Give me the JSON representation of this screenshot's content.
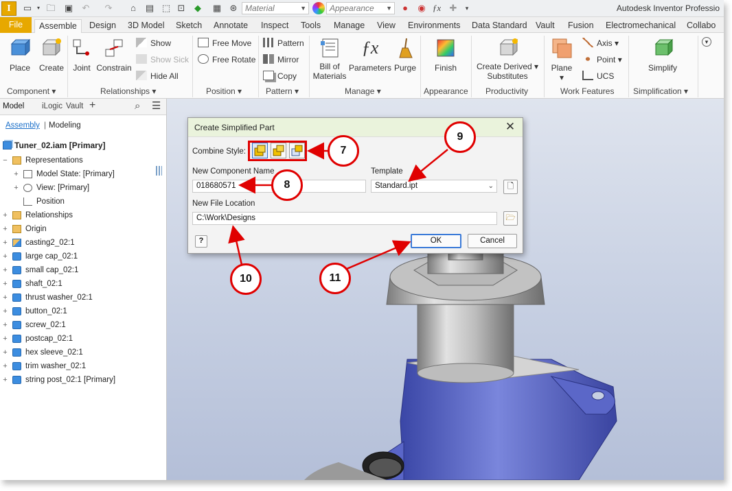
{
  "app": {
    "logo_letter": "I",
    "title": "Autodesk Inventor Professio",
    "material_placeholder": "Material",
    "appearance_placeholder": "Appearance"
  },
  "tabs": [
    "File",
    "Assemble",
    "Design",
    "3D Model",
    "Sketch",
    "Annotate",
    "Inspect",
    "Tools",
    "Manage",
    "View",
    "Environments",
    "Data Standard",
    "Vault",
    "Fusion",
    "Electromechanical",
    "Collabo"
  ],
  "active_tab": "Assemble",
  "ribbon": {
    "component": {
      "label": "Component",
      "place": "Place",
      "create": "Create"
    },
    "relationships": {
      "label": "Relationships",
      "joint": "Joint",
      "constrain": "Constrain",
      "show": "Show",
      "show_sick": "Show Sick",
      "hide_all": "Hide All"
    },
    "position": {
      "label": "Position",
      "free_move": "Free Move",
      "free_rotate": "Free Rotate"
    },
    "pattern": {
      "label": "Pattern",
      "pattern": "Pattern",
      "mirror": "Mirror",
      "copy": "Copy"
    },
    "manage": {
      "label": "Manage",
      "bom_line1": "Bill of",
      "bom_line2": "Materials",
      "parameters": "Parameters",
      "purge": "Purge"
    },
    "appearance": {
      "label": "Appearance",
      "finish": "Finish"
    },
    "productivity": {
      "label": "Productivity",
      "create_derived_line1": "Create Derived",
      "create_derived_line2": "Substitutes"
    },
    "work_features": {
      "label": "Work Features",
      "plane": "Plane",
      "axis": "Axis",
      "point": "Point",
      "ucs": "UCS"
    },
    "simplification": {
      "label": "Simplification",
      "simplify": "Simplify"
    }
  },
  "browser": {
    "tabs": [
      "Model",
      "iLogic",
      "Vault"
    ],
    "subtabs": [
      "Assembly",
      "Modeling"
    ],
    "tree": [
      {
        "label": "Tuner_02.iam [Primary]",
        "level": 0,
        "expander": "",
        "icon": "assembly"
      },
      {
        "label": "Representations",
        "level": 0,
        "expander": "−",
        "icon": "folder"
      },
      {
        "label": "Model State: [Primary]",
        "level": 1,
        "expander": "+",
        "icon": "model-state"
      },
      {
        "label": "View: [Primary]",
        "level": 1,
        "expander": "+",
        "icon": "view"
      },
      {
        "label": "Position",
        "level": 1,
        "expander": "",
        "icon": "position"
      },
      {
        "label": "Relationships",
        "level": 0,
        "expander": "+",
        "icon": "relationships"
      },
      {
        "label": "Origin",
        "level": 0,
        "expander": "+",
        "icon": "folder"
      },
      {
        "label": "casting2_02:1",
        "level": 0,
        "expander": "+",
        "icon": "part-casting"
      },
      {
        "label": "large cap_02:1",
        "level": 0,
        "expander": "+",
        "icon": "part"
      },
      {
        "label": "small cap_02:1",
        "level": 0,
        "expander": "+",
        "icon": "part"
      },
      {
        "label": "shaft_02:1",
        "level": 0,
        "expander": "+",
        "icon": "part"
      },
      {
        "label": "thrust washer_02:1",
        "level": 0,
        "expander": "+",
        "icon": "part"
      },
      {
        "label": "button_02:1",
        "level": 0,
        "expander": "+",
        "icon": "part"
      },
      {
        "label": "screw_02:1",
        "level": 0,
        "expander": "+",
        "icon": "part"
      },
      {
        "label": "postcap_02:1",
        "level": 0,
        "expander": "+",
        "icon": "part"
      },
      {
        "label": "hex sleeve_02:1",
        "level": 0,
        "expander": "+",
        "icon": "part"
      },
      {
        "label": "trim washer_02:1",
        "level": 0,
        "expander": "+",
        "icon": "part"
      },
      {
        "label": "string post_02:1 [Primary]",
        "level": 0,
        "expander": "+",
        "icon": "part"
      }
    ]
  },
  "dialog": {
    "title": "Create Simplified Part",
    "combine_style_label": "Combine Style:",
    "new_component_name_label": "New Component Name",
    "new_component_name_value": "018680571",
    "template_label": "Template",
    "template_value": "Standard.ipt",
    "new_file_location_label": "New File Location",
    "new_file_location_value": "C:\\Work\\Designs",
    "ok_label": "OK",
    "cancel_label": "Cancel"
  },
  "callouts": [
    "7",
    "8",
    "9",
    "10",
    "11"
  ],
  "colors": {
    "accent_file_tab": "#e7a800",
    "callout_red": "#e00000",
    "dialog_title_bg": "#eaf3dc",
    "part_blue": "#3c8de0",
    "model_blue": "#5a66c8",
    "model_gray": "#c8c8c8"
  }
}
